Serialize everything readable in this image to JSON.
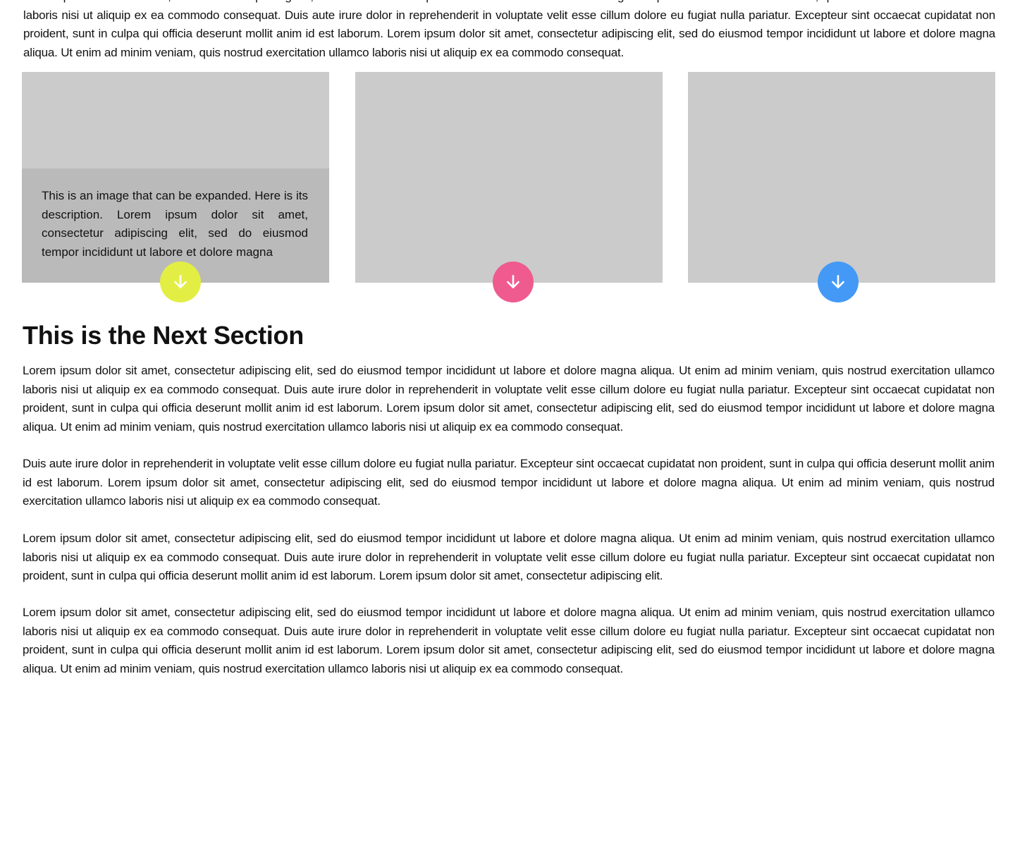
{
  "intro": {
    "text": "Lorem ipsum dolor sit amet, consectetur adipiscing elit, sed do eiusmod tempor incididunt ut labore et dolore magna aliqua. Ut enim ad minim veniam, quis nostrud exercitation ullamco laboris nisi ut aliquip ex ea commodo consequat. Duis aute irure dolor in reprehenderit in voluptate velit esse cillum dolore eu fugiat nulla pariatur. Excepteur sint occaecat cupidatat non proident, sunt in culpa qui officia deserunt mollit anim id est laborum. Lorem ipsum dolor sit amet, consectetur adipiscing elit, sed do eiusmod tempor incididunt ut labore et dolore magna aliqua. Ut enim ad minim veniam, quis nostrud exercitation ullamco laboris nisi ut aliquip ex ea commodo consequat."
  },
  "gallery": {
    "cards": [
      {
        "description": "This is an image that can be expanded. Here is its description. Lorem ipsum dolor sit amet, consectetur adipiscing elit, sed do eiusmod tempor incididunt ut labore et dolore magna",
        "button_color": "#e3ee44",
        "button_icon": "arrow-down-icon"
      },
      {
        "button_color": "#ef5b8e",
        "button_icon": "arrow-down-icon"
      },
      {
        "button_color": "#4499f7",
        "button_icon": "arrow-down-icon"
      }
    ]
  },
  "next_section": {
    "heading": "This is the Next Section",
    "paragraphs": [
      "Lorem ipsum dolor sit amet, consectetur adipiscing elit, sed do eiusmod tempor incididunt ut labore et dolore magna aliqua. Ut enim ad minim veniam, quis nostrud exercitation ullamco laboris nisi ut aliquip ex ea commodo consequat. Duis aute irure dolor in reprehenderit in voluptate velit esse cillum dolore eu fugiat nulla pariatur. Excepteur sint occaecat cupidatat non proident, sunt in culpa qui officia deserunt mollit anim id est laborum. Lorem ipsum dolor sit amet, consectetur adipiscing elit, sed do eiusmod tempor incididunt ut labore et dolore magna aliqua. Ut enim ad minim veniam, quis nostrud exercitation ullamco laboris nisi ut aliquip ex ea commodo consequat.",
      "Duis aute irure dolor in reprehenderit in voluptate velit esse cillum dolore eu fugiat nulla pariatur. Excepteur sint occaecat cupidatat non proident, sunt in culpa qui officia deserunt mollit anim id est laborum. Lorem ipsum dolor sit amet, consectetur adipiscing elit, sed do eiusmod tempor incididunt ut labore et dolore magna aliqua. Ut enim ad minim veniam, quis nostrud exercitation ullamco laboris nisi ut aliquip ex ea commodo consequat.",
      "Lorem ipsum dolor sit amet, consectetur adipiscing elit, sed do eiusmod tempor incididunt ut labore et dolore magna aliqua. Ut enim ad minim veniam, quis nostrud exercitation ullamco laboris nisi ut aliquip ex ea commodo consequat. Duis aute irure dolor in reprehenderit in voluptate velit esse cillum dolore eu fugiat nulla pariatur. Excepteur sint occaecat cupidatat non proident, sunt in culpa qui officia deserunt mollit anim id est laborum. Lorem ipsum dolor sit amet, consectetur adipiscing elit.",
      "Lorem ipsum dolor sit amet, consectetur adipiscing elit, sed do eiusmod tempor incididunt ut labore et dolore magna aliqua. Ut enim ad minim veniam, quis nostrud exercitation ullamco laboris nisi ut aliquip ex ea commodo consequat. Duis aute irure dolor in reprehenderit in voluptate velit esse cillum dolore eu fugiat nulla pariatur. Excepteur sint occaecat cupidatat non proident, sunt in culpa qui officia deserunt mollit anim id est laborum. Lorem ipsum dolor sit amet, consectetur adipiscing elit, sed do eiusmod tempor incididunt ut labore et dolore magna aliqua. Ut enim ad minim veniam, quis nostrud exercitation ullamco laboris nisi ut aliquip ex ea commodo consequat."
    ]
  }
}
